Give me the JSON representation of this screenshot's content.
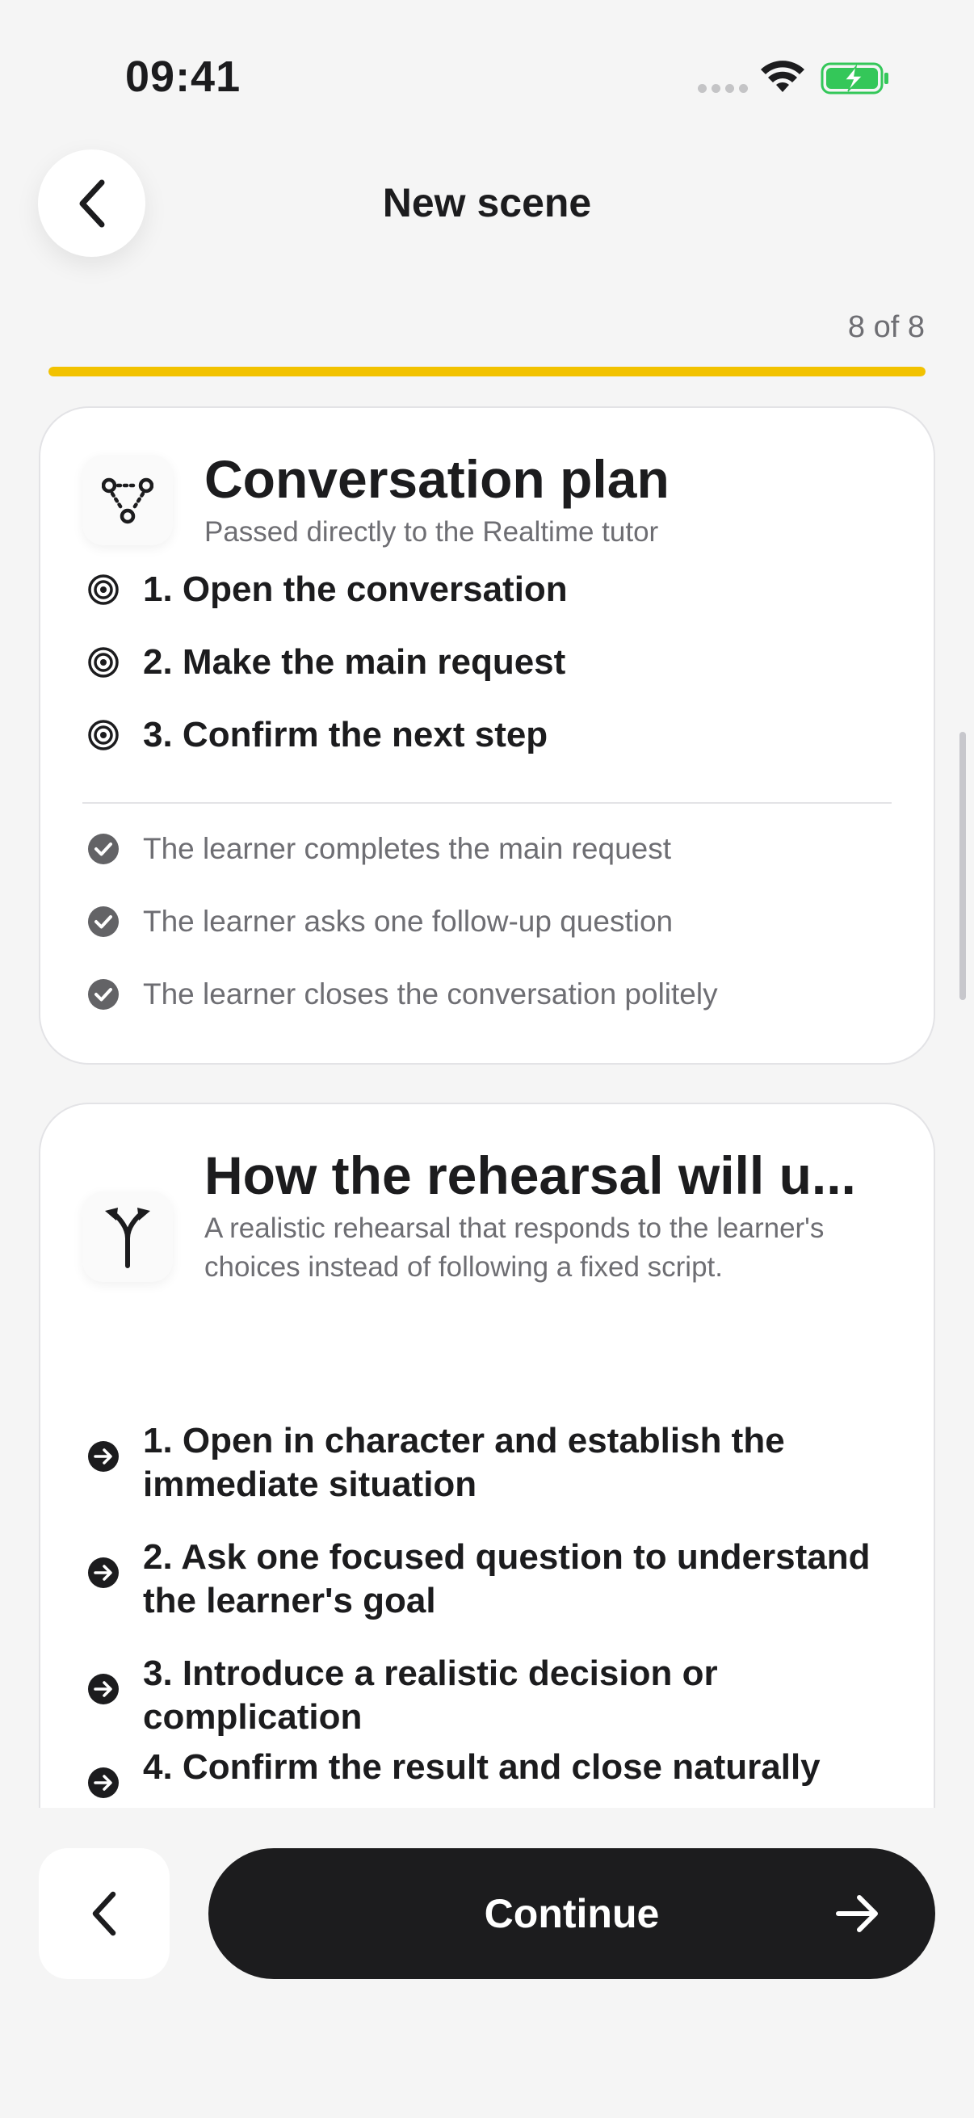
{
  "status_bar": {
    "time": "09:41"
  },
  "header": {
    "title": "New scene",
    "back_icon": "chevron-left-icon"
  },
  "progress": {
    "text": "8 of 8",
    "fraction": 1.0,
    "color": "#f2c200"
  },
  "plan_card": {
    "icon": "branching-nodes-icon",
    "title": "Conversation plan",
    "subtitle": "Passed directly to the Realtime tutor",
    "steps": [
      {
        "icon": "target-icon",
        "label": "1. Open the conversation"
      },
      {
        "icon": "target-icon",
        "label": "2. Make the main request"
      },
      {
        "icon": "target-icon",
        "label": "3. Confirm the next step"
      }
    ],
    "criteria": [
      {
        "icon": "check-circle-icon",
        "label": "The learner completes the main request"
      },
      {
        "icon": "check-circle-icon",
        "label": "The learner asks one follow-up question"
      },
      {
        "icon": "check-circle-icon",
        "label": "The learner closes the conversation politely"
      }
    ]
  },
  "rehearsal_card": {
    "icon": "fork-arrow-icon",
    "title": "How the rehearsal will u...",
    "subtitle": "A realistic rehearsal that responds to the learner's choices instead of following a fixed script.",
    "beats": [
      {
        "icon": "arrow-circle-icon",
        "label": "1. Open in character and establish the immediate situation"
      },
      {
        "icon": "arrow-circle-icon",
        "label": "2. Ask one focused question to understand the learner's goal"
      },
      {
        "icon": "arrow-circle-icon",
        "label": "3. Introduce a realistic decision or complication"
      },
      {
        "icon": "arrow-circle-icon",
        "label": "4. Confirm the result and close naturally"
      }
    ]
  },
  "footer": {
    "back_icon": "chevron-left-icon",
    "continue_label": "Continue",
    "continue_icon": "arrow-right-icon"
  },
  "colors": {
    "accent": "#f2c200",
    "primary_button": "#1c1c1e",
    "background": "#f5f5f5"
  }
}
